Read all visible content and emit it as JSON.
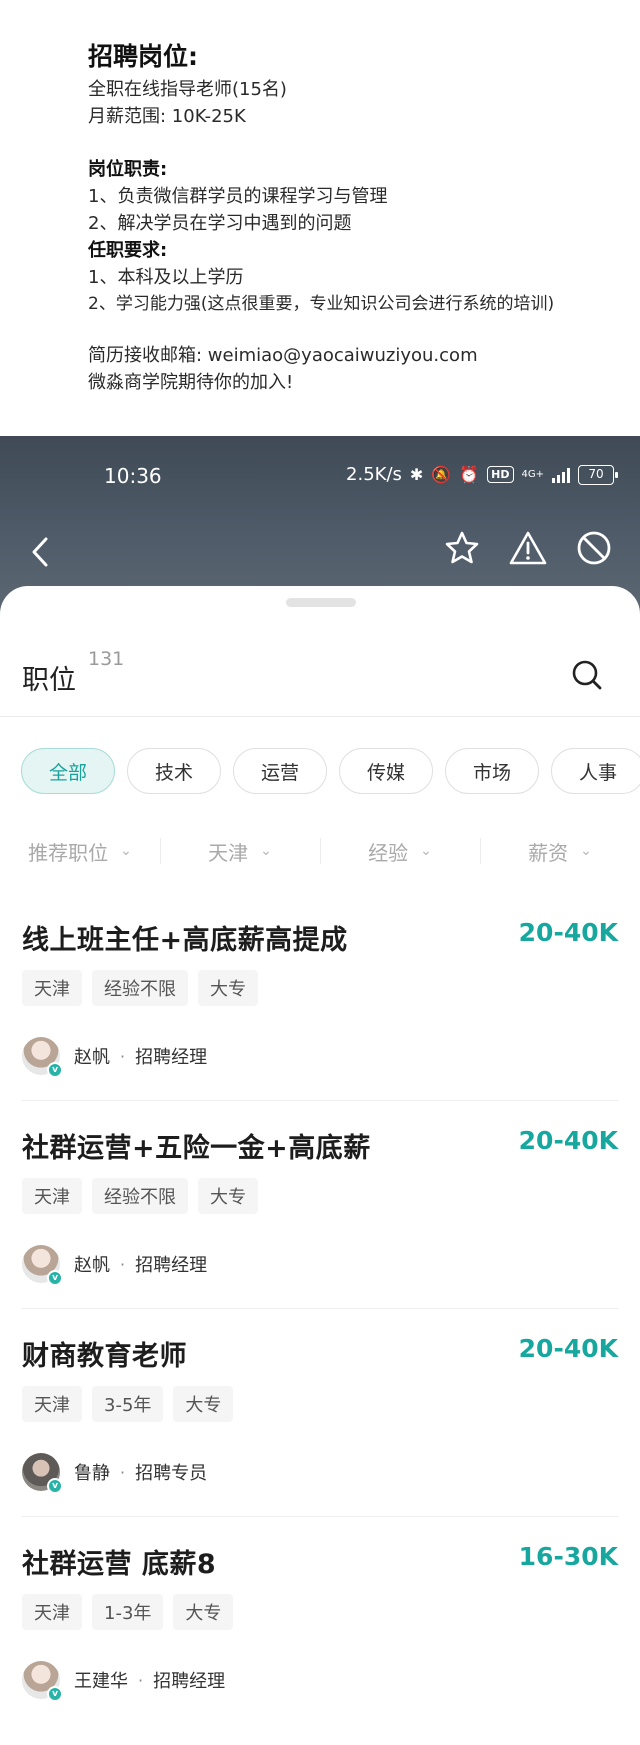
{
  "notice": {
    "heading": "招聘岗位:",
    "position_line": "全职在线指导老师(15名)",
    "salary_line": "月薪范围: 10K-25K",
    "duties_heading": "岗位职责:",
    "duty_1": "1、负责微信群学员的课程学习与管理",
    "duty_2": "2、解决学员在学习中遇到的问题",
    "requirements_heading": "任职要求:",
    "req_1": "1、本科及以上学历",
    "req_2": "2、学习能力强(这点很重要，专业知识公司会进行系统的培训)",
    "email_line": "简历接收邮箱: weimiao@yaocaiwuziyou.com",
    "closing_line": "微淼商学院期待你的加入!"
  },
  "statusbar": {
    "time": "10:36",
    "speed": "2.5K/s",
    "network": "4G+",
    "hd": "HD",
    "battery": "70"
  },
  "sheet": {
    "title": "职位",
    "count": "131"
  },
  "chips": [
    {
      "label": "全部",
      "active": true
    },
    {
      "label": "技术"
    },
    {
      "label": "运营"
    },
    {
      "label": "传媒"
    },
    {
      "label": "市场"
    },
    {
      "label": "人事"
    }
  ],
  "filters": [
    {
      "label": "推荐职位"
    },
    {
      "label": "天津"
    },
    {
      "label": "经验"
    },
    {
      "label": "薪资"
    }
  ],
  "jobs": [
    {
      "title": "线上班主任+高底薪高提成",
      "salary": "20-40K",
      "tags": [
        "天津",
        "经验不限",
        "大专"
      ],
      "recruiter": "赵帆",
      "role": "招聘经理"
    },
    {
      "title": "社群运营+五险一金+高底薪",
      "salary": "20-40K",
      "tags": [
        "天津",
        "经验不限",
        "大专"
      ],
      "recruiter": "赵帆",
      "role": "招聘经理"
    },
    {
      "title": "财商教育老师",
      "salary": "20-40K",
      "tags": [
        "天津",
        "3-5年",
        "大专"
      ],
      "recruiter": "鲁静",
      "role": "招聘专员"
    },
    {
      "title": "社群运营 底薪8",
      "salary": "16-30K",
      "tags": [
        "天津",
        "1-3年",
        "大专"
      ],
      "recruiter": "王建华",
      "role": "招聘经理"
    }
  ],
  "icons": {
    "back": "chevron-left-icon",
    "favorite": "star-icon",
    "report": "warning-icon",
    "block": "block-icon",
    "search": "search-icon"
  },
  "colors": {
    "accent": "#18a79e",
    "header_bg": "#4a5562"
  }
}
